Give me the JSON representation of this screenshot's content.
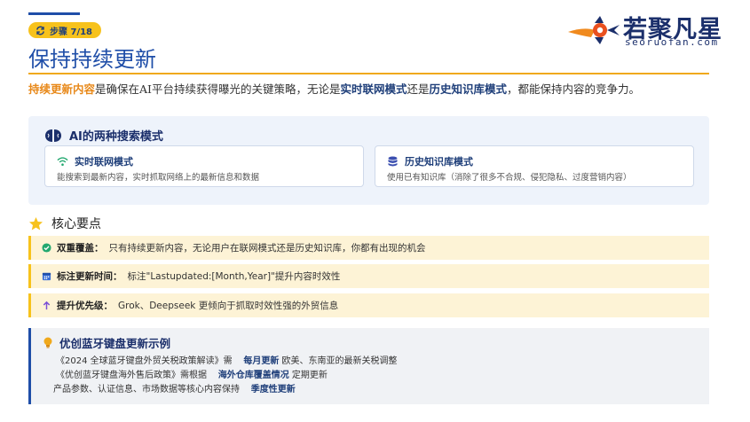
{
  "header": {
    "step_label": "步骤 7/18",
    "title": "保持持续更新"
  },
  "logo": {
    "text": "若聚凡星",
    "sub": "seoruofan.com"
  },
  "intro": {
    "part1": "持续更新内容",
    "part2": "是确保在AI平台持续获得曝光的关键策略，无论是",
    "part3": "实时联网模式",
    "part4": "还是",
    "part5": "历史知识库模式",
    "part6": "，都能保持内容的竞争力。"
  },
  "modes": {
    "heading": "AI的两种搜索模式",
    "realtime": {
      "title": "实时联网模式",
      "desc": "能搜索到最新内容，实时抓取网络上的最新信息和数据"
    },
    "history": {
      "title": "历史知识库模式",
      "desc": "使用已有知识库（消除了很多不合规、侵犯隐私、过度营销内容）"
    }
  },
  "key_points": {
    "heading": "核心要点",
    "items": [
      {
        "label": "双重覆盖：",
        "text": "只有持续更新内容，无论用户在联网模式还是历史知识库，你都有出现的机会",
        "icon": "check-circle-icon"
      },
      {
        "label": "标注更新时间：",
        "text": "标注\"Lastupdated:[Month,Year]\"提升内容时效性",
        "icon": "calendar-icon"
      },
      {
        "label": "提升优先级：",
        "text": "Grok、Deepseek 更倾向于抓取时效性强的外贸信息",
        "icon": "arrow-up-icon"
      }
    ]
  },
  "example": {
    "heading": "优创蓝牙键盘更新示例",
    "lines": [
      {
        "a": "《2024 全球蓝牙键盘外贸关税政策解读》需",
        "b": "每月更新",
        "c": "欧美、东南亚的最新关税调整"
      },
      {
        "a": "《优创蓝牙键盘海外售后政策》需根据",
        "b": "海外仓库覆盖情况",
        "c": "定期更新"
      },
      {
        "a": "产品参数、认证信息、市场数据等核心内容保持",
        "b": "季度性更新",
        "c": ""
      }
    ]
  },
  "colors": {
    "brand_blue": "#1f4ea8",
    "accent_orange": "#e8891a",
    "accent_yellow": "#f7c21c"
  }
}
